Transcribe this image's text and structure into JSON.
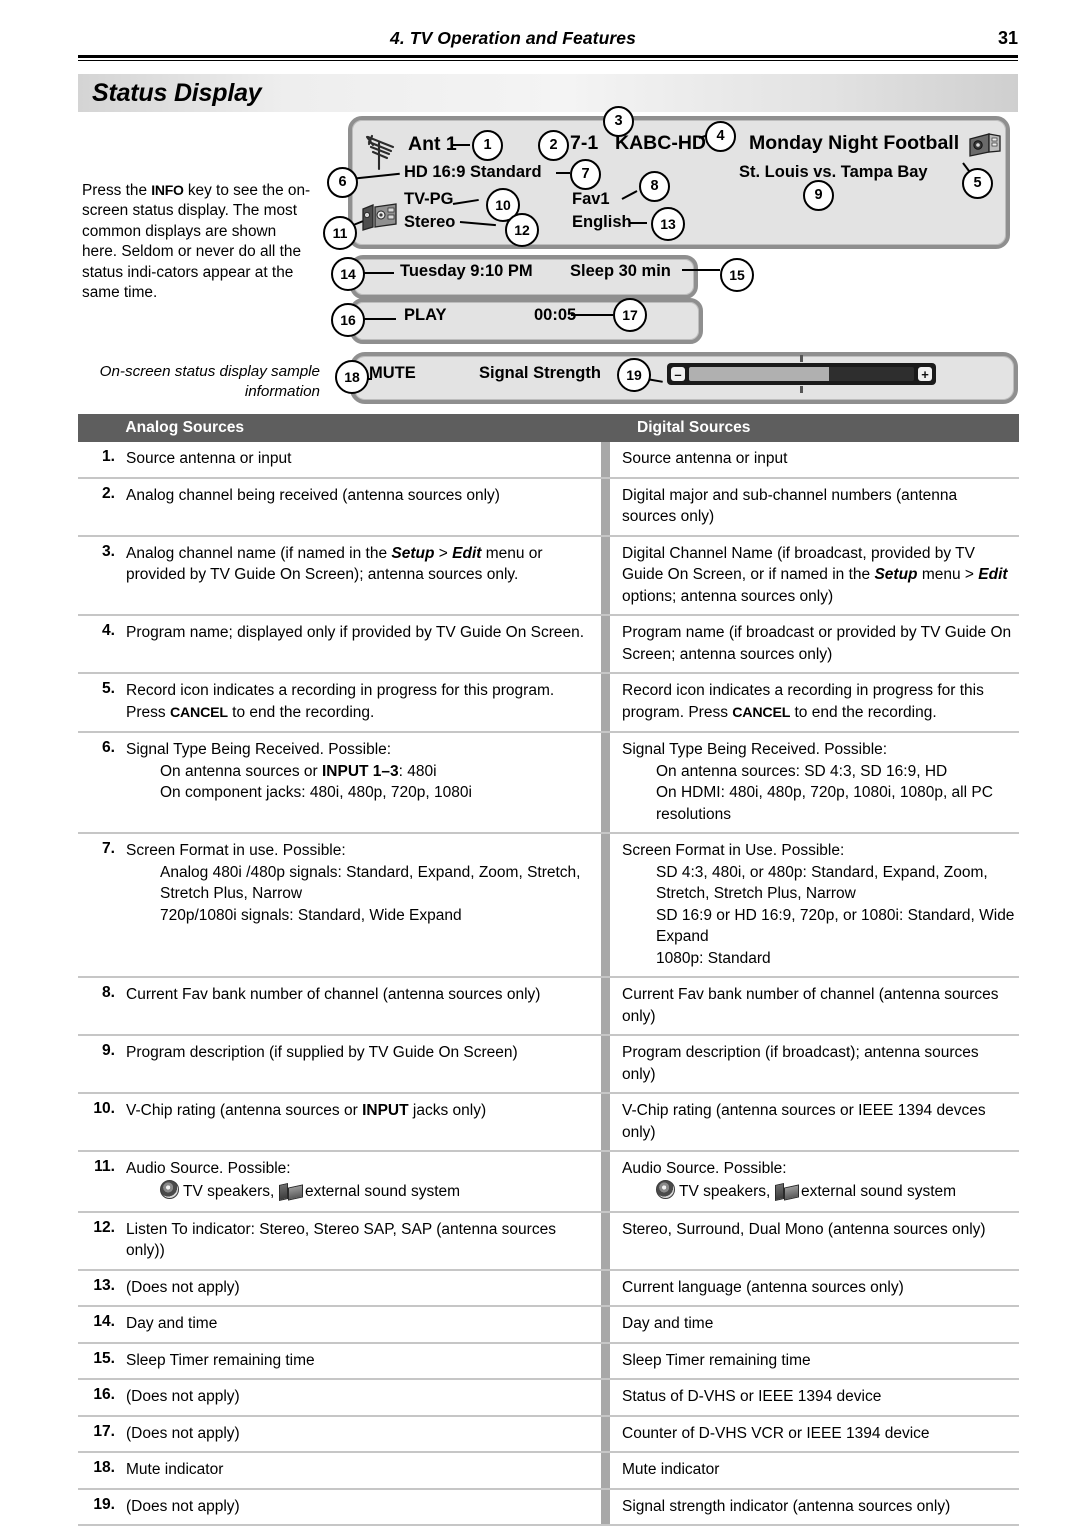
{
  "runhead": {
    "chapter_title": "4.  TV Operation and Features",
    "page_number": "31"
  },
  "section": {
    "banner_title": "Status Display"
  },
  "intro": {
    "line_1_pre": "Press the ",
    "key_info": "INFO",
    "line_1_post": " key to see the on-screen status display. The most common displays are shown here.  Seldom or never do all the status indi-cators appear at the same time.",
    "caption": "On-screen status display sample information"
  },
  "osd": {
    "panel_main": {
      "source": "Ant 1",
      "channel_number": "7-1",
      "channel_name": "KABC-HD",
      "program_title": "Monday Night Football",
      "signal_format": "HD 16:9 Standard",
      "program_desc": "St. Louis vs. Tampa Bay",
      "vchip": "TV-PG",
      "fav_bank": "Fav1",
      "audio_listen": "Stereo",
      "language": "English",
      "antenna_icon": "antenna-icon",
      "record_icon": "record-camera-icon",
      "sound_system_icon": "external-sound-system-icon"
    },
    "panel_time": {
      "day_time": "Tuesday 9:10 PM",
      "sleep_timer": "Sleep 30 min"
    },
    "panel_transport": {
      "status": "PLAY",
      "counter": "00:05"
    },
    "panel_mute": {
      "mute": "MUTE",
      "signal_label": "Signal Strength",
      "minus_glyph": "–",
      "plus_glyph": "+",
      "fill_percent": 62
    },
    "callouts": [
      "1",
      "2",
      "3",
      "4",
      "5",
      "6",
      "7",
      "8",
      "9",
      "10",
      "11",
      "12",
      "13",
      "14",
      "15",
      "16",
      "17",
      "18",
      "19"
    ]
  },
  "table": {
    "headers": {
      "number": "",
      "analog": "Analog Sources",
      "digital": "Digital Sources"
    },
    "rows": [
      {
        "n": "1.",
        "analog": "Source antenna or input",
        "digital": "Source antenna or input"
      },
      {
        "n": "2.",
        "analog": "Analog channel being received (antenna sources only)",
        "digital": "Digital major and sub-channel numbers (antenna sources only)"
      },
      {
        "n": "3.",
        "analog_html": "Analog channel name (if named in the <i>Setup</i> &gt; <i>Edit</i> menu or provided by TV Guide On Screen); antenna sources only.",
        "digital_html": "Digital Channel Name (if broadcast, provided by TV Guide On Screen, or if named in the <i>Setup</i> menu &gt; <i>Edit</i> options; antenna sources only)"
      },
      {
        "n": "4.",
        "analog": "Program name; displayed only if provided by TV Guide On Screen.",
        "digital": "Program name (if broadcast or provided by TV Guide On Screen; antenna sources only)"
      },
      {
        "n": "5.",
        "analog_html": "Record icon indicates a recording in progress for this program.  Press <span class=\"kbd\">CANCEL</span> to end the recording.",
        "digital_html": "Record icon indicates a recording in progress for this program.  Press <span class=\"kbd\">CANCEL</span> to end the recording."
      },
      {
        "n": "6.",
        "analog_html": "Signal Type Being Received.  Possible:<span class=\"ind\">On antenna sources or <b>INPUT 1–3</b>:  480i</span><span class=\"ind\">On component jacks:  480i, 480p, 720p, 1080i</span>",
        "digital_html": "Signal Type Being Received.  Possible:<span class=\"ind\">On antenna sources:  SD 4:3, SD 16:9, HD</span><span class=\"ind\">On HDMI:  480i, 480p, 720p, 1080i, 1080p, all PC resolutions</span>"
      },
      {
        "n": "7.",
        "analog_html": "Screen Format in use.  Possible:<span class=\"ind\">Analog 480i /480p signals:  Standard, Expand, Zoom, Stretch, Stretch Plus, Narrow</span><span class=\"ind\">720p/1080i signals:  Standard, Wide Expand</span>",
        "digital_html": "Screen Format in Use.  Possible:<span class=\"ind\">SD 4:3, 480i, or 480p:  Standard, Expand, Zoom, Stretch, Stretch Plus, Narrow</span><span class=\"ind\">SD 16:9 or HD 16:9, 720p, or 1080i:  Standard, Wide Expand</span><span class=\"ind\">1080p:  Standard</span>"
      },
      {
        "n": "8.",
        "analog": "Current Fav bank number of channel (antenna sources only)",
        "digital": "Current Fav bank number of channel (antenna sources only)"
      },
      {
        "n": "9.",
        "analog": "Program description (if supplied by TV Guide On Screen)",
        "digital": "Program description (if broadcast); antenna sources only)"
      },
      {
        "n": "10.",
        "analog_html": "V-Chip rating (antenna sources or <b>INPUT</b> jacks only)",
        "digital": "V-Chip rating (antenna sources or IEEE 1394 devces only)"
      },
      {
        "n": "11.",
        "analog_html": "Audio Source.  Possible:<span class=\"ind ico-line\"><span class=\"mini-spk\"></span> TV speakers, <span class=\"mini-sys\"></span> external sound system</span>",
        "digital_html": "Audio Source.  Possible:<span class=\"ind ico-line\"><span class=\"mini-spk\"></span> TV speakers, <span class=\"mini-sys\"></span> external sound system</span>"
      },
      {
        "n": "12.",
        "analog": "Listen To indicator:  Stereo, Stereo SAP, SAP (antenna sources only))",
        "digital": "Stereo, Surround, Dual Mono (antenna sources only)"
      },
      {
        "n": "13.",
        "analog": "(Does not apply)",
        "digital": "Current language (antenna sources only)"
      },
      {
        "n": "14.",
        "analog": "Day and time",
        "digital": "Day and time"
      },
      {
        "n": "15.",
        "analog": "Sleep Timer remaining time",
        "digital": "Sleep Timer remaining time"
      },
      {
        "n": "16.",
        "analog": "(Does not apply)",
        "digital": "Status of D-VHS or IEEE 1394 device"
      },
      {
        "n": "17.",
        "analog": "(Does not apply)",
        "digital": "Counter of D-VHS VCR or IEEE 1394 device"
      },
      {
        "n": "18.",
        "analog": "Mute indicator",
        "digital": "Mute indicator"
      },
      {
        "n": "19.",
        "analog": "(Does not apply)",
        "digital": "Signal strength indicator (antenna sources only)"
      }
    ]
  },
  "colors": {
    "header_band": "#5e5e5e",
    "row_divider": "#c6c6c6",
    "column_divider": "#a8a8a8",
    "osd_fill": "#e3e3e3",
    "osd_border": "#8f8f8f",
    "bar_frame": "#1a1a1a",
    "bar_fill": "#b0b0b0"
  }
}
